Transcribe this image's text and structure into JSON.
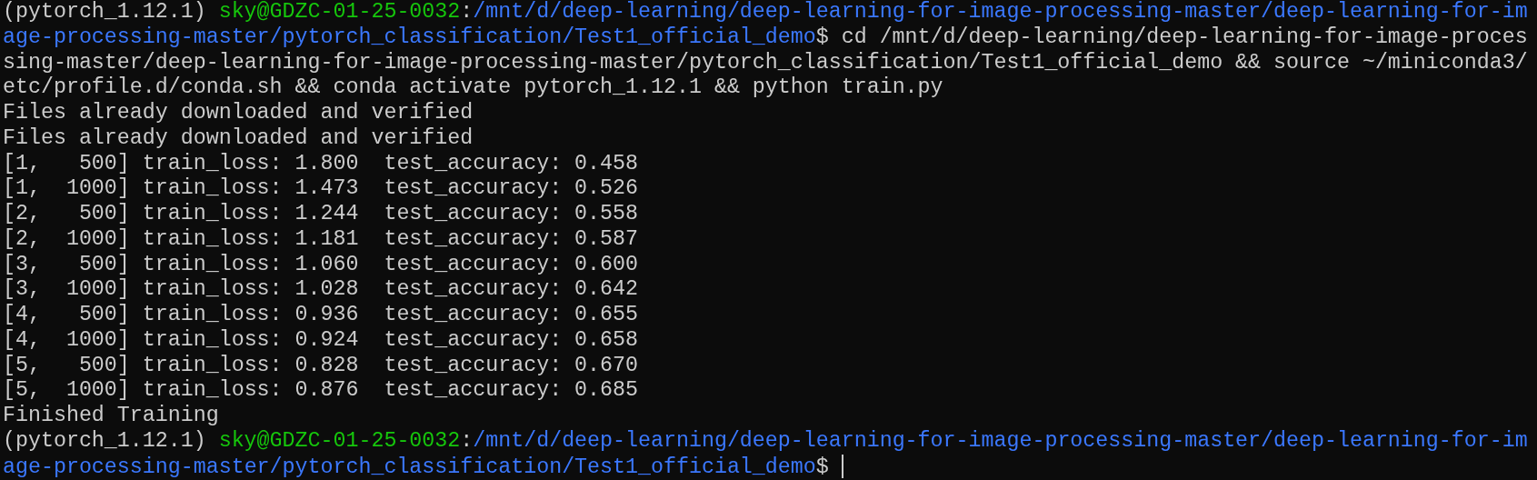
{
  "terminal": {
    "cursor_visible": true,
    "rows": [
      {
        "segments": [
          {
            "kind": "env",
            "text": "(pytorch_1.12.1)"
          },
          {
            "kind": "user_host",
            "text": "sky@GDZC-01-25-0032"
          },
          {
            "kind": "separator",
            "text": ":"
          },
          {
            "kind": "path",
            "text": "/mnt/d/deep-learning/deep-learning-for-image-processing-master/deep-learning-for-im"
          }
        ]
      },
      {
        "segments": [
          {
            "kind": "path",
            "text": "age-processing-master/pytorch_classification/Test1_official_demo"
          },
          {
            "kind": "symbol",
            "text": "$"
          },
          {
            "kind": "command",
            "text": "cd /mnt/d/deep-learning/deep-learning-for-image-proces"
          }
        ]
      },
      {
        "segments": [
          {
            "kind": "output",
            "text": "sing-master/deep-learning-for-image-processing-master/pytorch_classification/Test1_official_demo && source ~/miniconda3/"
          }
        ]
      },
      {
        "segments": [
          {
            "kind": "output",
            "text": "etc/profile.d/conda.sh && conda activate pytorch_1.12.1 && python train.py"
          }
        ]
      },
      {
        "segments": [
          {
            "kind": "output",
            "text": "Files already downloaded and verified"
          }
        ]
      },
      {
        "segments": [
          {
            "kind": "output",
            "text": "Files already downloaded and verified"
          }
        ]
      },
      {
        "segments": [
          {
            "kind": "output",
            "text": "[1,   500] train_loss: 1.800  test_accuracy: 0.458"
          }
        ]
      },
      {
        "segments": [
          {
            "kind": "output",
            "text": "[1,  1000] train_loss: 1.473  test_accuracy: 0.526"
          }
        ]
      },
      {
        "segments": [
          {
            "kind": "output",
            "text": "[2,   500] train_loss: 1.244  test_accuracy: 0.558"
          }
        ]
      },
      {
        "segments": [
          {
            "kind": "output",
            "text": "[2,  1000] train_loss: 1.181  test_accuracy: 0.587"
          }
        ]
      },
      {
        "segments": [
          {
            "kind": "output",
            "text": "[3,   500] train_loss: 1.060  test_accuracy: 0.600"
          }
        ]
      },
      {
        "segments": [
          {
            "kind": "output",
            "text": "[3,  1000] train_loss: 1.028  test_accuracy: 0.642"
          }
        ]
      },
      {
        "segments": [
          {
            "kind": "output",
            "text": "[4,   500] train_loss: 0.936  test_accuracy: 0.655"
          }
        ]
      },
      {
        "segments": [
          {
            "kind": "output",
            "text": "[4,  1000] train_loss: 0.924  test_accuracy: 0.658"
          }
        ]
      },
      {
        "segments": [
          {
            "kind": "output",
            "text": "[5,   500] train_loss: 0.828  test_accuracy: 0.670"
          }
        ]
      },
      {
        "segments": [
          {
            "kind": "output",
            "text": "[5,  1000] train_loss: 0.876  test_accuracy: 0.685"
          }
        ]
      },
      {
        "segments": [
          {
            "kind": "output",
            "text": "Finished Training"
          }
        ]
      },
      {
        "segments": [
          {
            "kind": "env",
            "text": "(pytorch_1.12.1)"
          },
          {
            "kind": "user_host",
            "text": "sky@GDZC-01-25-0032"
          },
          {
            "kind": "separator",
            "text": ":"
          },
          {
            "kind": "path",
            "text": "/mnt/d/deep-learning/deep-learning-for-image-processing-master/deep-learning-for-im"
          }
        ]
      },
      {
        "segments": [
          {
            "kind": "path",
            "text": "age-processing-master/pytorch_classification/Test1_official_demo"
          },
          {
            "kind": "symbol",
            "text": "$"
          }
        ]
      }
    ]
  }
}
